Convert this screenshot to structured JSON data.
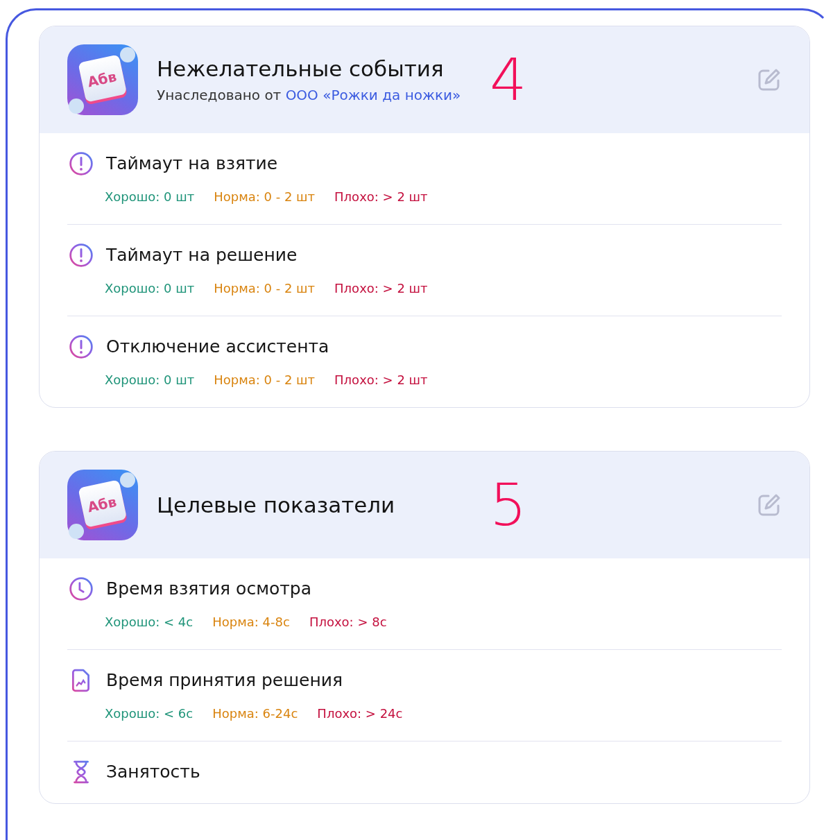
{
  "cards": [
    {
      "icon_text": "Абв",
      "title": "Нежелательные события",
      "subtitle": {
        "prefix": "Унаследовано от",
        "link": "ООО «Рожки да ножки»"
      },
      "annotation": "4",
      "items": [
        {
          "kind": "alert",
          "title": "Таймаут на взятие",
          "criteria": [
            {
              "kind": "good",
              "text": "Хорошо: 0 шт"
            },
            {
              "kind": "norm",
              "text": "Норма: 0 - 2 шт"
            },
            {
              "kind": "bad",
              "text": "Плохо: > 2 шт"
            }
          ]
        },
        {
          "kind": "alert",
          "title": "Таймаут на решение",
          "criteria": [
            {
              "kind": "good",
              "text": "Хорошо: 0 шт"
            },
            {
              "kind": "norm",
              "text": "Норма: 0 - 2 шт"
            },
            {
              "kind": "bad",
              "text": "Плохо: > 2 шт"
            }
          ]
        },
        {
          "kind": "alert",
          "title": "Отключение ассистента",
          "criteria": [
            {
              "kind": "good",
              "text": "Хорошо: 0 шт"
            },
            {
              "kind": "norm",
              "text": "Норма: 0 - 2 шт"
            },
            {
              "kind": "bad",
              "text": "Плохо: > 2 шт"
            }
          ]
        }
      ]
    },
    {
      "icon_text": "Абв",
      "title": "Целевые показатели",
      "annotation": "5",
      "items": [
        {
          "kind": "clock",
          "title": "Время взятия осмотра",
          "criteria": [
            {
              "kind": "good",
              "text": "Хорошо: < 4с"
            },
            {
              "kind": "norm",
              "text": "Норма: 4-8с"
            },
            {
              "kind": "bad",
              "text": "Плохо: > 8с"
            }
          ]
        },
        {
          "kind": "document",
          "title": "Время принятия решения",
          "criteria": [
            {
              "kind": "good",
              "text": "Хорошо: < 6с"
            },
            {
              "kind": "norm",
              "text": "Норма: 6-24с"
            },
            {
              "kind": "bad",
              "text": "Плохо: > 24с"
            }
          ]
        },
        {
          "kind": "hourglass",
          "title": "Занятость"
        }
      ]
    }
  ]
}
